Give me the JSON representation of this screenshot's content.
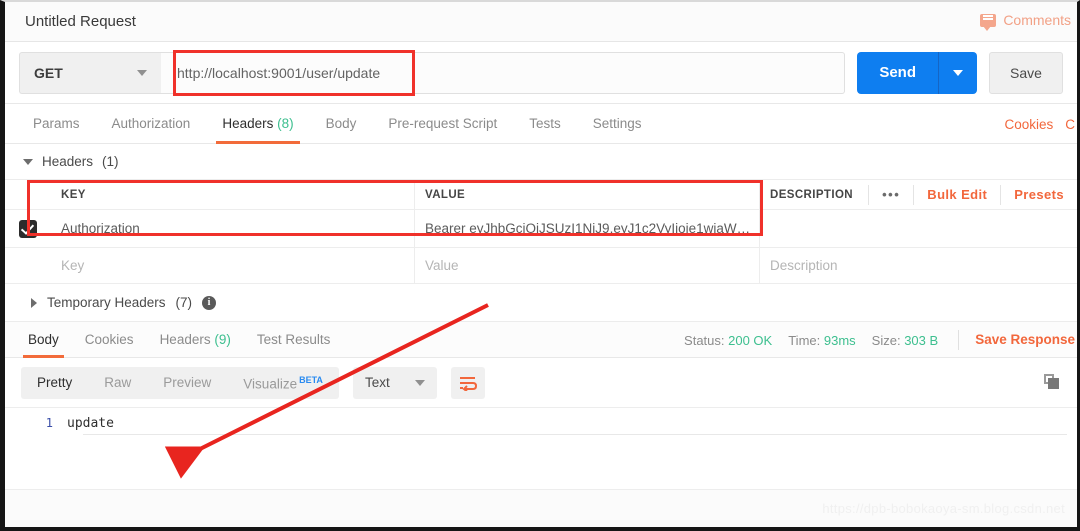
{
  "titlebar": {
    "request_name": "Untitled Request",
    "comments_label": "Comments",
    "comment_icon": "comment-icon"
  },
  "request": {
    "method": "GET",
    "url": "http://localhost:9001/user/update",
    "send_label": "Send",
    "save_label": "Save",
    "method_caret_icon": "chevron-down-icon",
    "send_caret_icon": "chevron-down-icon"
  },
  "request_tabs": [
    {
      "label": "Params",
      "count": "",
      "active": false
    },
    {
      "label": "Authorization",
      "count": "",
      "active": false
    },
    {
      "label": "Headers",
      "count": "(8)",
      "active": true
    },
    {
      "label": "Body",
      "count": "",
      "active": false
    },
    {
      "label": "Pre-request Script",
      "count": "",
      "active": false
    },
    {
      "label": "Tests",
      "count": "",
      "active": false
    },
    {
      "label": "Settings",
      "count": "",
      "active": false
    }
  ],
  "request_tabs_right": {
    "cookies": "Cookies",
    "code": "C"
  },
  "headers_section": {
    "title": "Headers",
    "count": "(1)",
    "collapse_icon": "triangle-down-icon",
    "columns": {
      "key": "KEY",
      "value": "VALUE",
      "description": "DESCRIPTION"
    },
    "actions": {
      "more": "•••",
      "bulk_edit": "Bulk Edit",
      "presets": "Presets"
    },
    "rows": [
      {
        "checked": true,
        "key": "Authorization",
        "value": "Bearer eyJhbGciOiJSUzI1NiJ9.eyJ1c2VyIjoie1wiaW…",
        "description": ""
      }
    ],
    "placeholder_row": {
      "key": "Key",
      "value": "Value",
      "description": "Description"
    }
  },
  "temporary_headers": {
    "label": "Temporary Headers",
    "count": "(7)",
    "expand_icon": "triangle-right-icon",
    "info_icon": "info-icon",
    "info_glyph": "i"
  },
  "response_tabs": [
    {
      "label": "Body",
      "count": "",
      "active": true
    },
    {
      "label": "Cookies",
      "count": "",
      "active": false
    },
    {
      "label": "Headers",
      "count": "(9)",
      "active": false
    },
    {
      "label": "Test Results",
      "count": "",
      "active": false
    }
  ],
  "response_meta": {
    "status_label": "Status:",
    "status_value": "200 OK",
    "time_label": "Time:",
    "time_value": "93ms",
    "size_label": "Size:",
    "size_value": "303 B",
    "save_response": "Save Response"
  },
  "body_toolbar": {
    "views": [
      {
        "label": "Pretty",
        "active": true
      },
      {
        "label": "Raw",
        "active": false
      },
      {
        "label": "Preview",
        "active": false
      },
      {
        "label": "Visualize",
        "active": false,
        "badge": "BETA"
      }
    ],
    "format": "Text",
    "format_caret_icon": "chevron-down-icon",
    "wrap_icon": "word-wrap-icon",
    "copy_icon": "copy-icon"
  },
  "response_body": {
    "lines": [
      {
        "number": "1",
        "text": "update"
      }
    ]
  },
  "footer": {
    "watermark": "https://dpb-bobokaoya-sm.blog.csdn.net"
  },
  "annotations": {
    "url_box": "red-rectangle-url",
    "row_box": "red-rectangle-auth-row",
    "arrow": "red-arrow-to-body"
  },
  "colors": {
    "accent_orange": "#f2673c",
    "send_blue": "#0e7ef0",
    "green": "#3dbf8f",
    "annotation_red": "#f0312a",
    "beta_blue": "#2a8bf0"
  }
}
